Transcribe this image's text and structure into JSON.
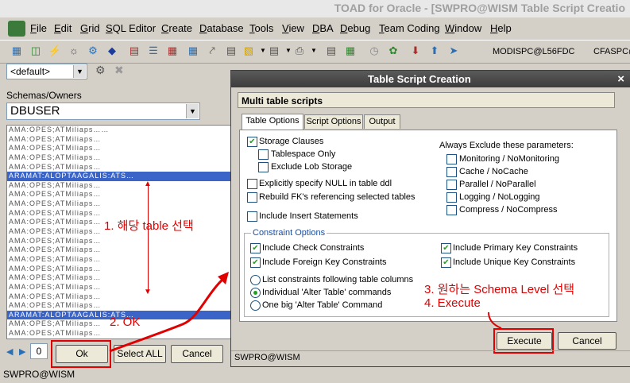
{
  "window": {
    "title": "TOAD for Oracle - [SWPRO@WISM Table Script Creatio"
  },
  "menu": [
    "File",
    "Edit",
    "Grid",
    "SQL Editor",
    "Create",
    "Database",
    "Tools",
    "View",
    "DBA",
    "Debug",
    "Team Coding",
    "Window",
    "Help"
  ],
  "toolbar": {
    "connection1": "MODISPC@L56FDC",
    "connection2": "CFASPC@"
  },
  "left": {
    "default_combo": "<default>",
    "schemas_label": "Schemas/Owners",
    "owner": "DBUSER",
    "page_num": "0",
    "ok": "Ok",
    "select_all": "Select ALL",
    "cancel": "Cancel",
    "status": "SWPRO@WISM"
  },
  "dialog": {
    "title": "Table Script Creation",
    "close": "×",
    "section": "Multi table scripts",
    "tabs": [
      "Table Options",
      "Script Options",
      "Output"
    ],
    "storage_clauses": "Storage Clauses",
    "tablespace_only": "Tablespace Only",
    "exclude_lob": "Exclude Lob Storage",
    "explicit_null": "Explicitly specify NULL in table ddl",
    "rebuild_fk": "Rebuild FK's referencing selected tables",
    "include_insert": "Include Insert Statements",
    "always_exclude": "Always Exclude these parameters:",
    "exclude_opts": [
      "Monitoring / NoMonitoring",
      "Cache / NoCache",
      "Parallel / NoParallel",
      "Logging / NoLogging",
      "Compress / NoCompress"
    ],
    "constraint_options": "Constraint Options",
    "check_constraints": "Include Check Constraints",
    "primary_key": "Include Primary Key Constraints",
    "foreign_key": "Include Foreign Key Constraints",
    "unique_key": "Include Unique Key Constraints",
    "radio_following": "List constraints following table columns",
    "radio_individual": "Individual 'Alter Table' commands",
    "radio_big": "One big 'Alter Table' Command",
    "execute": "Execute",
    "cancel": "Cancel",
    "status": "SWPRO@WISM"
  },
  "annotations": {
    "a1": "1. 해당 table 선택",
    "a2": "2. OK",
    "a3": "3. 원하는  Schema Level 선택",
    "a4": "4.  Execute"
  },
  "colors": {
    "annotation": "#e00000",
    "selection": "#3a64c8",
    "dialog_title": "#404040"
  }
}
